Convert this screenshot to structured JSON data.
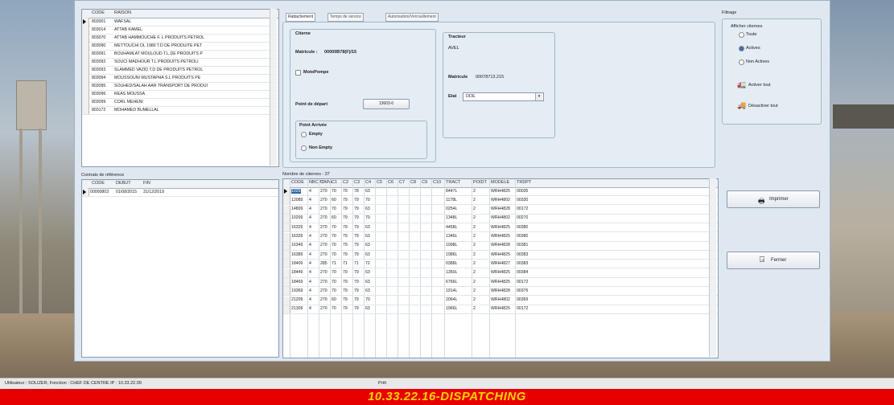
{
  "entreprises": {
    "headers": [
      "CODE",
      "RAISON"
    ],
    "rows": [
      [
        "803001",
        "WAFSAL"
      ],
      [
        "803014",
        "ATTAB KAMEL"
      ],
      [
        "803070",
        "ATTAB HAMMOUCHE F. L PRODUITS PETROL"
      ],
      [
        "803090",
        "METTOUCHI DL 1980 T.D DE PRODUITE PET"
      ],
      [
        "803091",
        "BOUHAMLAT MOULOUD T.L.DE PRODUITS P"
      ],
      [
        "803092",
        "SOUCI MADHOUR T.L PRODUITS PETROLI"
      ],
      [
        "803093",
        "SLAMMED VAZID T.D DE PRODUITS PETROL"
      ],
      [
        "803094",
        "MOUSSOUNI MUSTAPHA S.L PRODUITS PE"
      ],
      [
        "803095",
        "SOUHED/SALAH AAR TRANSPORT DE PRODUI"
      ],
      [
        "803096",
        "REAS MOUSSA"
      ],
      [
        "803099",
        "CORL MEHENI"
      ],
      [
        "803172",
        "MOHAMED BUMELLAL"
      ]
    ]
  },
  "contrats": {
    "title": "Contrats de référence",
    "headers": [
      "CODE",
      "DEBUT",
      "FIN"
    ],
    "rows": [
      [
        "00000803",
        "01/08/2015",
        "31/12/2019"
      ]
    ]
  },
  "tabs": [
    "Rattachement",
    "Temps de service",
    "Autorisation/Verrouillement"
  ],
  "citerne": {
    "title": "Citerne",
    "matricule_label": "Matricule :",
    "matricule_value": "00000B78(F)/15",
    "motopompe": "MotoPompe",
    "point_depart_label": "Point de départ",
    "point_depart_value": "13603-0",
    "point_arrivee_title": "Point Arrivée",
    "opt_empty": "Empty",
    "opt_non_empty": "Non Empty"
  },
  "tracteur": {
    "title": "Tracteur",
    "name": "AVEL",
    "matricule_label": "Matricule",
    "matricule_value": "00078713.215",
    "etat_label": "Etat",
    "etat_value": "DDE"
  },
  "filtrage": {
    "title": "Filtrage",
    "afficher": "Afficher citernes",
    "options": [
      "Toute",
      "Actives",
      "Non Actives"
    ],
    "selected": 1,
    "activer_btn": "Activer tout",
    "desactiver_btn": "Désactiver tout"
  },
  "citernes_grid": {
    "title": "Nombre de citernes : 37",
    "headers": [
      "CODE",
      "NBCPT",
      "CAPA",
      "C1",
      "C2",
      "C3",
      "C4",
      "C5",
      "C6",
      "C7",
      "C8",
      "C9",
      "C10",
      "TRACT",
      "POIDT",
      "MODELE",
      "TRDPT"
    ],
    "rows": [
      [
        "1029",
        "4",
        "270",
        "70",
        "79",
        "78",
        "63",
        "",
        "",
        "",
        "",
        "",
        "",
        "8447L",
        "2",
        "WRH4825",
        "00035"
      ],
      [
        "12089",
        "4",
        "270",
        "60",
        "79",
        "79",
        "70",
        "",
        "",
        "",
        "",
        "",
        "",
        "1178L",
        "2",
        "WRH4802",
        "00330"
      ],
      [
        "14809",
        "4",
        "270",
        "70",
        "79",
        "79",
        "63",
        "",
        "",
        "",
        "",
        "",
        "",
        "0254L",
        "2",
        "WRH4828",
        "00172"
      ],
      [
        "10209",
        "4",
        "270",
        "60",
        "79",
        "79",
        "70",
        "",
        "",
        "",
        "",
        "",
        "",
        "1348L",
        "2",
        "WRH4802",
        "00270"
      ],
      [
        "16329",
        "4",
        "270",
        "70",
        "79",
        "79",
        "63",
        "",
        "",
        "",
        "",
        "",
        "",
        "4458L",
        "2",
        "WRH4825",
        "00380"
      ],
      [
        "16339",
        "4",
        "270",
        "70",
        "79",
        "79",
        "63",
        "",
        "",
        "",
        "",
        "",
        "",
        "1346L",
        "2",
        "WRH4825",
        "00380"
      ],
      [
        "16349",
        "4",
        "270",
        "70",
        "79",
        "79",
        "63",
        "",
        "",
        "",
        "",
        "",
        "",
        "1998L",
        "2",
        "WRH4828",
        "00381"
      ],
      [
        "16389",
        "4",
        "270",
        "70",
        "79",
        "79",
        "63",
        "",
        "",
        "",
        "",
        "",
        "",
        "1986L",
        "2",
        "WRH4825",
        "00383"
      ],
      [
        "18409",
        "4",
        "285",
        "71",
        "71",
        "71",
        "72",
        "",
        "",
        "",
        "",
        "",
        "",
        "0388L",
        "2",
        "WRH4827",
        "00383"
      ],
      [
        "18449",
        "4",
        "270",
        "70",
        "79",
        "79",
        "63",
        "",
        "",
        "",
        "",
        "",
        "",
        "1350L",
        "2",
        "WRH4825",
        "00384"
      ],
      [
        "18469",
        "4",
        "270",
        "70",
        "79",
        "79",
        "63",
        "",
        "",
        "",
        "",
        "",
        "",
        "6766L",
        "2",
        "WRH4825",
        "00172"
      ],
      [
        "19369",
        "4",
        "270",
        "70",
        "79",
        "79",
        "63",
        "",
        "",
        "",
        "",
        "",
        "",
        "1914L",
        "2",
        "WRH4828",
        "00376"
      ],
      [
        "21209",
        "4",
        "270",
        "60",
        "79",
        "79",
        "70",
        "",
        "",
        "",
        "",
        "",
        "",
        "2064L",
        "2",
        "WRH4802",
        "00369"
      ],
      [
        "21309",
        "4",
        "270",
        "70",
        "79",
        "79",
        "63",
        "",
        "",
        "",
        "",
        "",
        "",
        "1966L",
        "2",
        "WRH4825",
        "00172"
      ]
    ]
  },
  "buttons": {
    "imprimer": "Imprimer",
    "fermer": "Fermer"
  },
  "status": {
    "user_text": "Utilisateur : SOLIZER, Fonction : CHEF DE CENTRE    IP : 10.33.22.09",
    "mid_text": "Prêt",
    "banner": "10.33.22.16-DISPATCHING"
  },
  "colors": {
    "banner_bg": "#e60000",
    "banner_text": "#ffd400",
    "window_bg": "#dfe8f1"
  }
}
